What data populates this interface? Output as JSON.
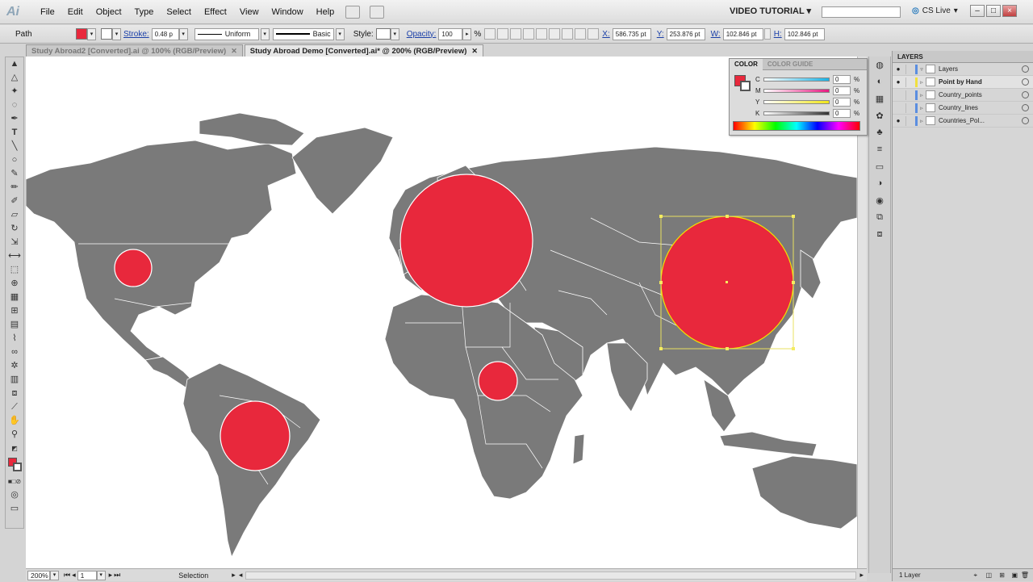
{
  "menubar": {
    "logo": "Ai",
    "items": [
      "File",
      "Edit",
      "Object",
      "Type",
      "Select",
      "Effect",
      "View",
      "Window",
      "Help"
    ],
    "workspace": "VIDEO TUTORIAL",
    "cslive": "CS Live"
  },
  "controlbar": {
    "selection_type": "Path",
    "stroke_label": "Stroke:",
    "stroke_weight": "0.48 p",
    "stroke_profile": "Uniform",
    "brush": "Basic",
    "style_label": "Style:",
    "opacity_label": "Opacity:",
    "opacity_value": "100",
    "opacity_unit": "%",
    "x_label": "X:",
    "x_value": "586.735 pt",
    "y_label": "Y:",
    "y_value": "253.876 pt",
    "w_label": "W:",
    "w_value": "102.846 pt",
    "h_label": "H:",
    "h_value": "102.846 pt",
    "fill_color": "#e8283c"
  },
  "tabs": [
    {
      "label": "Study Abroad2 [Converted].ai @ 100% (RGB/Preview)",
      "active": false
    },
    {
      "label": "Study Abroad Demo [Converted].ai* @ 200% (RGB/Preview)",
      "active": true
    }
  ],
  "color_panel": {
    "tabs": [
      "COLOR",
      "COLOR GUIDE"
    ],
    "channels": [
      {
        "label": "C",
        "value": "0",
        "color": "#19b3e6"
      },
      {
        "label": "M",
        "value": "0",
        "color": "#e61980"
      },
      {
        "label": "Y",
        "value": "0",
        "color": "#f0e619"
      },
      {
        "label": "K",
        "value": "0",
        "color": "#333333"
      }
    ],
    "unit": "%"
  },
  "layers_panel": {
    "title": "LAYERS",
    "rows": [
      {
        "name": "Layers",
        "bold": false,
        "eye": true
      },
      {
        "name": "Point by Hand",
        "bold": true,
        "eye": true
      },
      {
        "name": "Country_points",
        "bold": false,
        "eye": false
      },
      {
        "name": "Country_lines",
        "bold": false,
        "eye": false
      },
      {
        "name": "Countries_Pol...",
        "bold": false,
        "eye": true
      }
    ],
    "footer": "1 Layer"
  },
  "statusbar": {
    "zoom": "200%",
    "page": "1",
    "tool": "Selection"
  },
  "map": {
    "land_color": "#7a7a7a",
    "bubble_color": "#e8283c",
    "bubbles": [
      {
        "region": "United States",
        "size": 0.27
      },
      {
        "region": "Europe",
        "size": 1.0
      },
      {
        "region": "Central Africa",
        "size": 0.29
      },
      {
        "region": "South America",
        "size": 0.52
      },
      {
        "region": "China",
        "size": 1.0,
        "selected": true
      }
    ]
  }
}
